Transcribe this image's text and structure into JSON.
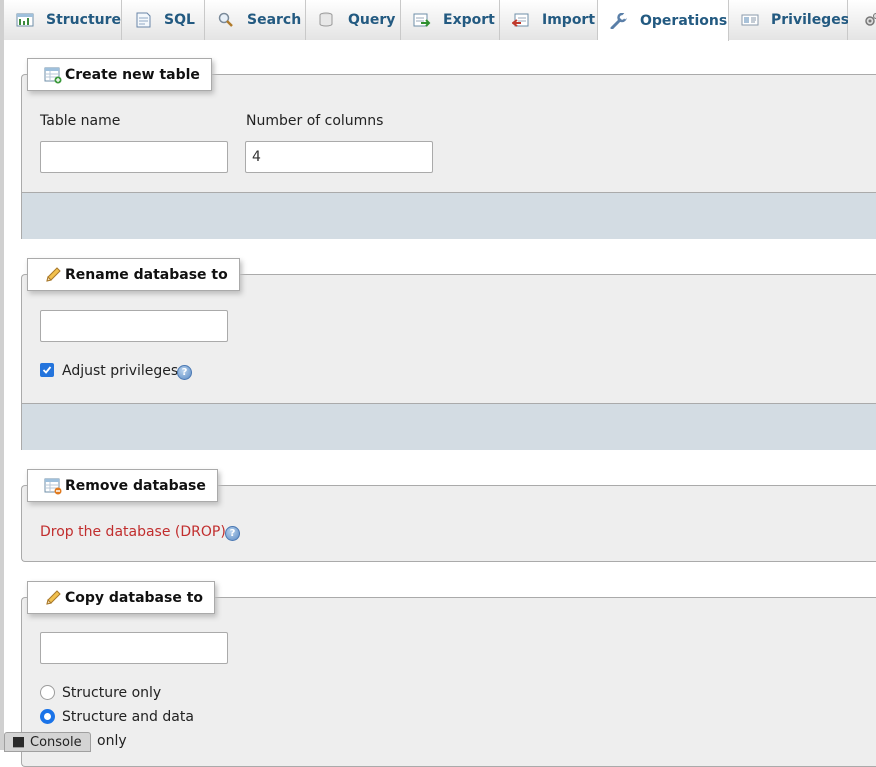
{
  "tabs": [
    {
      "label": "Structure",
      "icon": "structure-icon",
      "active": false
    },
    {
      "label": "SQL",
      "icon": "sql-icon",
      "active": false
    },
    {
      "label": "Search",
      "icon": "search-icon",
      "active": false
    },
    {
      "label": "Query",
      "icon": "query-icon",
      "active": false
    },
    {
      "label": "Export",
      "icon": "export-icon",
      "active": false
    },
    {
      "label": "Import",
      "icon": "import-icon",
      "active": false
    },
    {
      "label": "Operations",
      "icon": "wrench-icon",
      "active": true
    },
    {
      "label": "Privileges",
      "icon": "privileges-icon",
      "active": false
    }
  ],
  "create_table": {
    "legend": "Create new table",
    "table_name_label": "Table name",
    "table_name_value": "",
    "num_columns_label": "Number of columns",
    "num_columns_value": "4"
  },
  "rename_db": {
    "legend": "Rename database to",
    "name_value": "",
    "adjust_privileges_label": "Adjust privileges",
    "adjust_privileges_checked": true
  },
  "remove_db": {
    "legend": "Remove database",
    "drop_link": "Drop the database (DROP)"
  },
  "copy_db": {
    "legend": "Copy database to",
    "name_value": "",
    "options": [
      {
        "label": "Structure only",
        "selected": false
      },
      {
        "label": "Structure and data",
        "selected": true
      },
      {
        "label": "only",
        "selected": false
      }
    ]
  },
  "console": {
    "label": "Console"
  },
  "colors": {
    "tab_text": "#235a81",
    "fieldset_bg": "#eeeeee",
    "action_bar": "#d3dce3",
    "drop_link": "#c12e2e",
    "checkbox": "#2474dc"
  }
}
